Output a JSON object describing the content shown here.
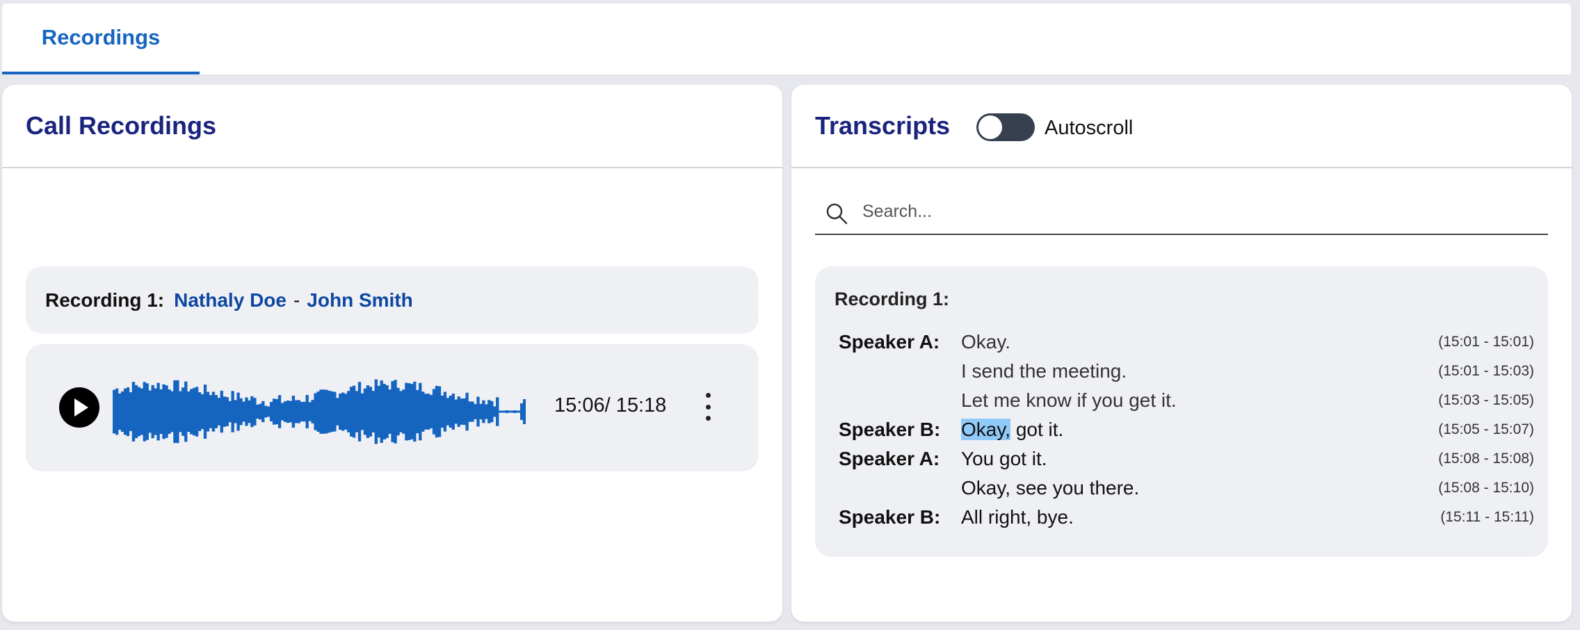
{
  "tabs": [
    {
      "label": "Recordings",
      "active": true
    }
  ],
  "left": {
    "title": "Call Recordings",
    "recording": {
      "label": "Recording 1:",
      "person1": "Nathaly Doe",
      "separator": "-",
      "person2": "John Smith"
    },
    "player": {
      "time": "15:06/ 15:18",
      "play_icon": "play-icon",
      "more_icon": "more-vertical-icon"
    }
  },
  "right": {
    "title": "Transcripts",
    "autoscroll_label": "Autoscroll",
    "autoscroll_on": false,
    "search": {
      "placeholder": "Search...",
      "value": ""
    },
    "transcript": {
      "recording_label": "Recording 1:",
      "lines": [
        {
          "speaker": "Speaker A:",
          "text": "Okay.",
          "time": "(15:01 - 15:01)"
        },
        {
          "speaker": "",
          "text": "I send the meeting.",
          "time": "(15:01 - 15:03)"
        },
        {
          "speaker": "",
          "text": "Let me know if you get it.",
          "time": "(15:03 - 15:05)"
        },
        {
          "speaker": "Speaker B:",
          "text_highlight": "Okay,",
          "text_rest": " got it.",
          "time": "(15:05 - 15:07)"
        },
        {
          "speaker": "Speaker A:",
          "text": "You got it.",
          "time": "(15:08 - 15:08)"
        },
        {
          "speaker": "",
          "text": "Okay, see you there.",
          "time": "(15:08 - 15:10)"
        },
        {
          "speaker": "Speaker B:",
          "text": "All right, bye.",
          "time": "(15:11 - 15:11)"
        }
      ]
    }
  },
  "colors": {
    "accent": "#1565c0",
    "title": "#1a237e",
    "waveform": "#1565c0",
    "highlight": "#90caf9"
  }
}
